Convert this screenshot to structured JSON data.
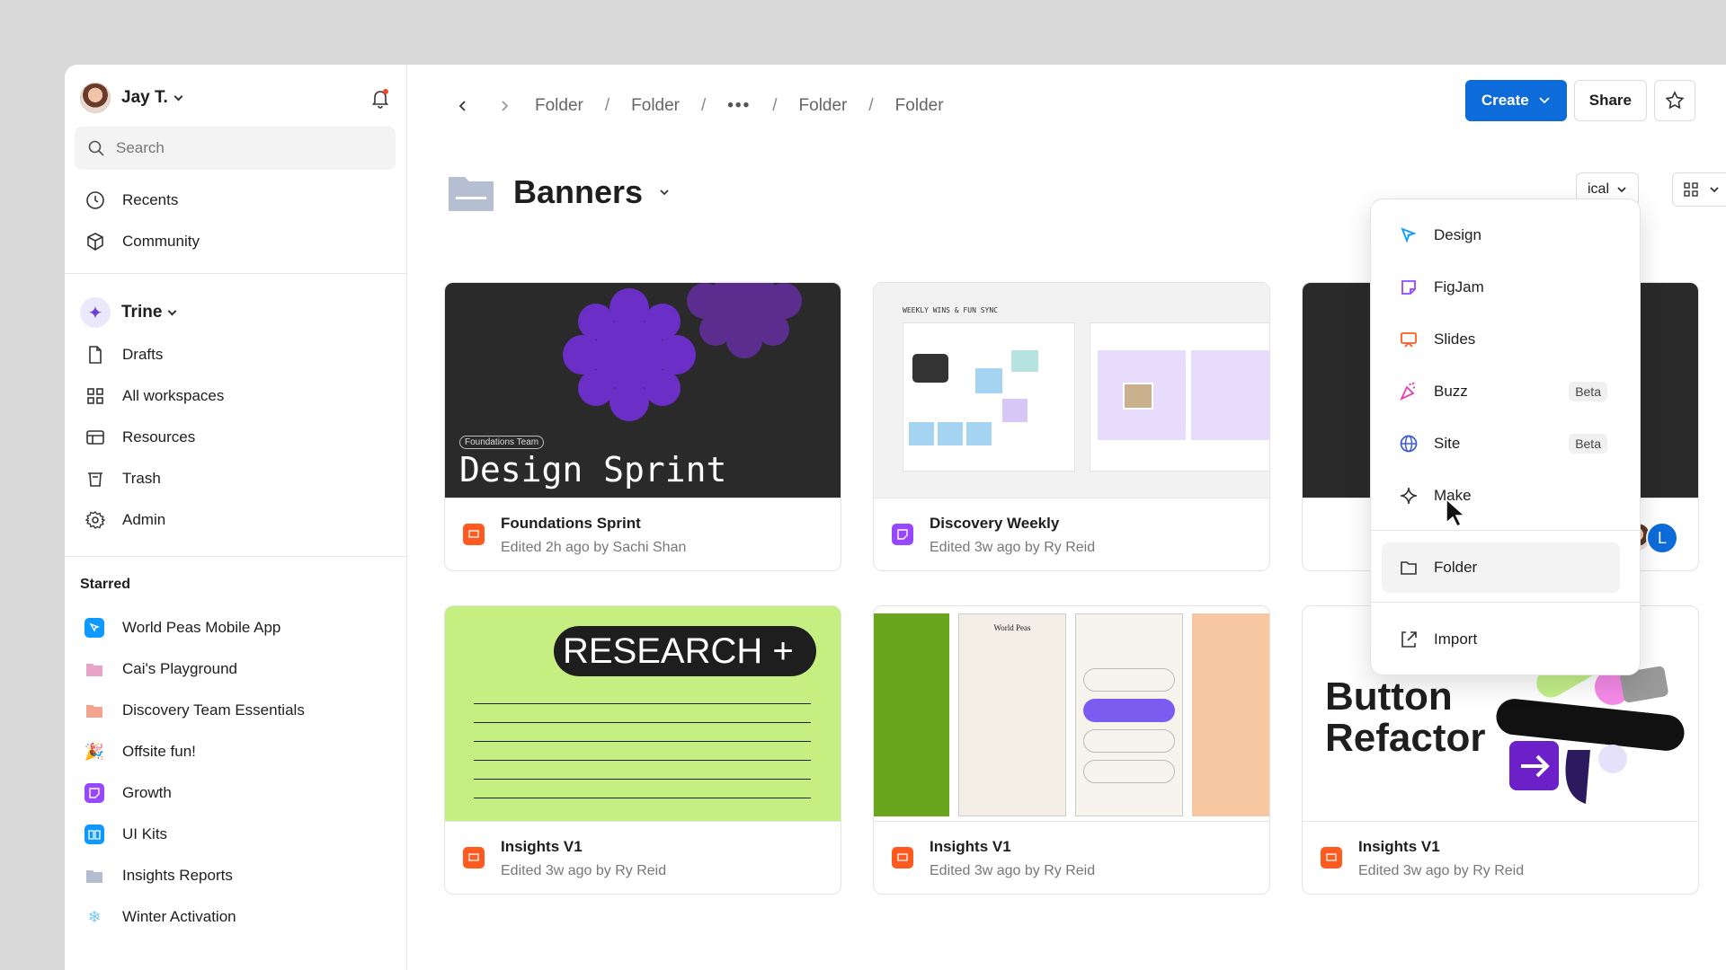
{
  "user": {
    "name": "Jay T."
  },
  "search": {
    "placeholder": "Search"
  },
  "nav_top": [
    {
      "label": "Recents",
      "icon": "clock-icon"
    },
    {
      "label": "Community",
      "icon": "community-icon"
    }
  ],
  "workspace": {
    "name": "Trine"
  },
  "nav_ws": [
    {
      "label": "Drafts",
      "icon": "file-icon"
    },
    {
      "label": "All workspaces",
      "icon": "grid-icon"
    },
    {
      "label": "Resources",
      "icon": "resources-icon"
    },
    {
      "label": "Trash",
      "icon": "trash-icon"
    },
    {
      "label": "Admin",
      "icon": "gear-icon"
    }
  ],
  "starred": {
    "heading": "Starred",
    "items": [
      {
        "label": "World Peas Mobile App",
        "icon": "design-file-icon",
        "color": "#0d99ff"
      },
      {
        "label": "Cai's Playground",
        "icon": "folder-icon",
        "color": "#e9a3c7"
      },
      {
        "label": "Discovery Team Essentials",
        "icon": "folder-icon",
        "color": "#f4a38f"
      },
      {
        "label": "Offsite fun!",
        "icon": "party-icon",
        "color": "#f5b700"
      },
      {
        "label": "Growth",
        "icon": "figjam-file-icon",
        "color": "#9747ff"
      },
      {
        "label": "UI Kits",
        "icon": "book-icon",
        "color": "#0d99ff"
      },
      {
        "label": "Insights Reports",
        "icon": "folder-icon",
        "color": "#b4bdd0"
      },
      {
        "label": "Winter Activation",
        "icon": "snowflake-icon",
        "color": "#7ec8f0"
      }
    ]
  },
  "breadcrumb": [
    "Folder",
    "Folder",
    "Folder",
    "Folder"
  ],
  "toolbar": {
    "create_label": "Create",
    "share_label": "Share"
  },
  "page": {
    "title": "Banners",
    "sort_label": "ical"
  },
  "cards": [
    {
      "name": "Foundations Sprint",
      "sub": "Edited 2h ago by Sachi Shan",
      "tag": "Foundations Team",
      "thumb_title": "Design Sprint",
      "type": "slides"
    },
    {
      "name": "Discovery Weekly",
      "sub": "Edited 3w ago by Ry Reid",
      "thumb_title": "WEEKLY WINS & FUN SYNC",
      "type": "figjam"
    },
    {
      "name": "",
      "sub": "",
      "type": "slides"
    },
    {
      "name": "Insights V1",
      "sub": "Edited 3w ago by Ry Reid",
      "thumb_title": "RESEARCH +",
      "type": "slides"
    },
    {
      "name": "Insights V1",
      "sub": "Edited 3w ago by Ry Reid",
      "thumb_title": "World Peas",
      "type": "slides"
    },
    {
      "name": "Insights V1",
      "sub": "Edited 3w ago by Ry Reid",
      "thumb_title": "Button Refactor",
      "type": "slides"
    }
  ],
  "menu": {
    "items": [
      {
        "label": "Design",
        "icon": "design-icon"
      },
      {
        "label": "FigJam",
        "icon": "figjam-icon"
      },
      {
        "label": "Slides",
        "icon": "slides-icon"
      },
      {
        "label": "Buzz",
        "icon": "buzz-icon",
        "badge": "Beta"
      },
      {
        "label": "Site",
        "icon": "globe-icon",
        "badge": "Beta"
      },
      {
        "label": "Make",
        "icon": "make-icon"
      },
      {
        "label": "Folder",
        "icon": "folder-icon"
      },
      {
        "label": "Import",
        "icon": "import-icon"
      }
    ]
  },
  "colors": {
    "accent": "#0d6cd9",
    "slides": "#ff5a1f",
    "figjam": "#9747ff",
    "research_bg": "#c6ef82",
    "purple": "#6b2fc7"
  }
}
